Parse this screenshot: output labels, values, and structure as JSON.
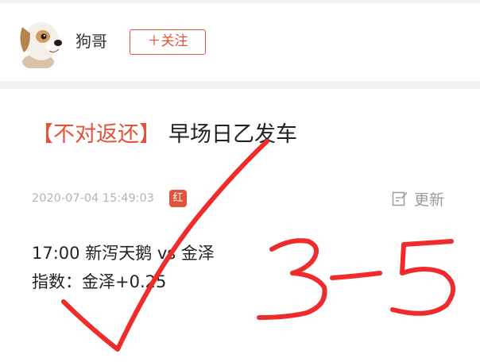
{
  "author": {
    "name": "狗哥",
    "avatar_icon": "dog-avatar-icon",
    "follow_label": "＋关注"
  },
  "post": {
    "tag": "【不对返还】",
    "title": "早场日乙发车",
    "date": "2020-07-04 15:49:03",
    "badge": "红",
    "update_label": "更新",
    "update_icon": "edit-icon",
    "match": "17:00 新泻天鹅 vs 金泽",
    "index": "指数：金泽+0.25"
  },
  "handwriting": {
    "score": "3-5",
    "mark": "check-mark",
    "color": "#ef2b2b"
  },
  "colors": {
    "accent": "#e3523a",
    "muted_text": "#b3b3b3",
    "separator": "#f2f2f2"
  }
}
